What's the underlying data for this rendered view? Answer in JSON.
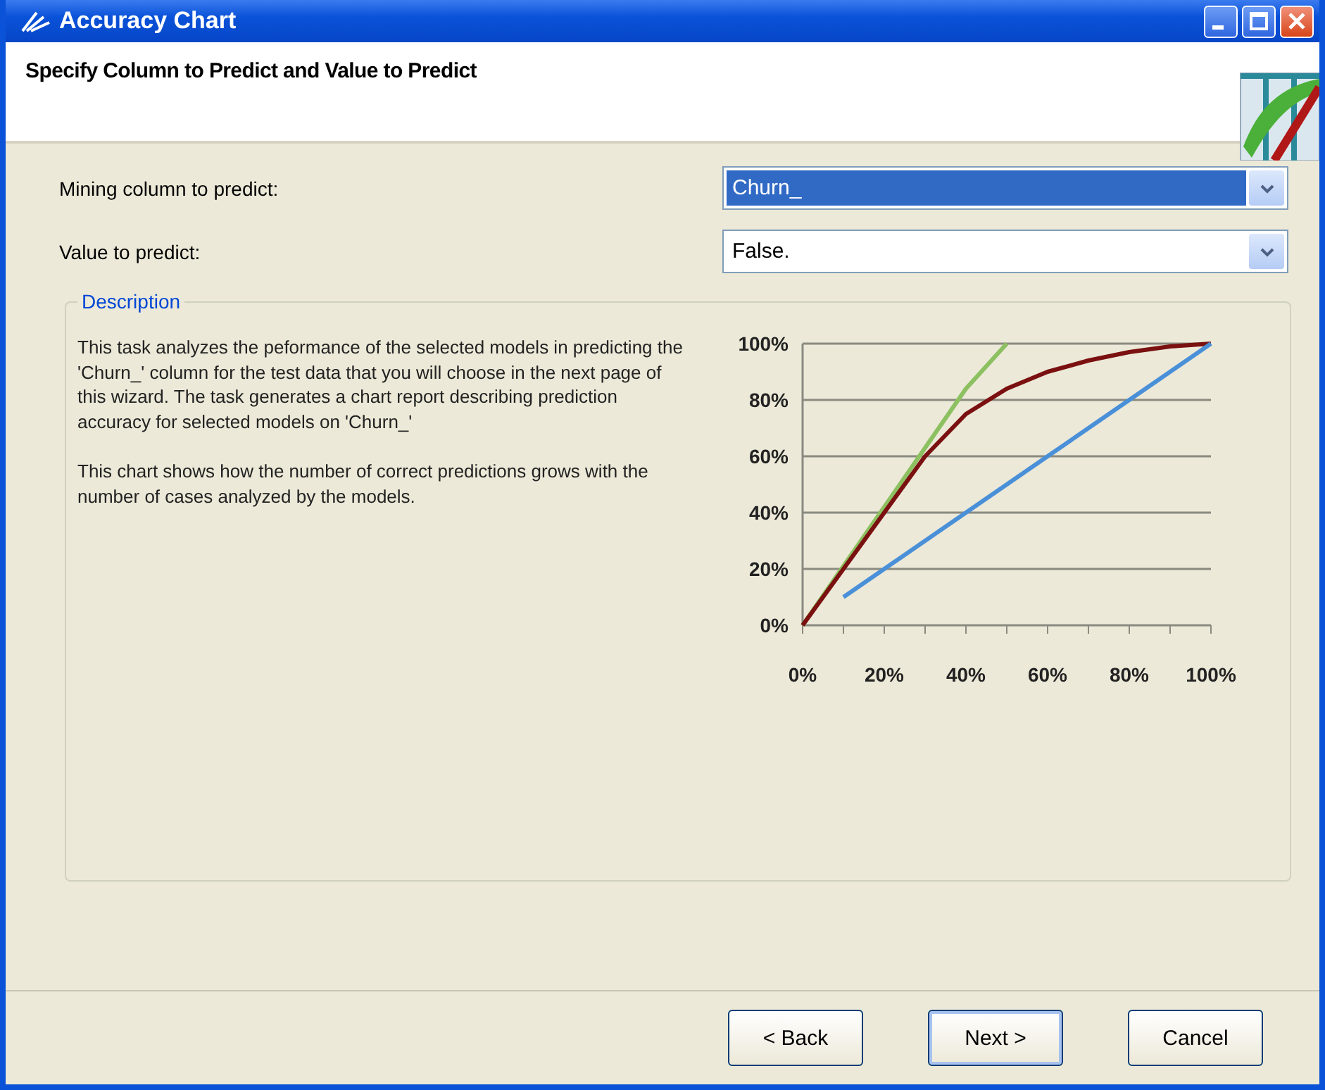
{
  "window": {
    "title": "Accuracy Chart",
    "controls": [
      {
        "kind": "minimize"
      },
      {
        "kind": "maximize"
      },
      {
        "kind": "close"
      }
    ]
  },
  "header": {
    "title": "Specify Column to Predict and Value to Predict"
  },
  "fields": [
    {
      "label": "Mining column to predict:",
      "value": "Churn_",
      "selected": true
    },
    {
      "label": "Value to predict:",
      "value": "False.",
      "selected": false
    }
  ],
  "description": {
    "legend": "Description",
    "paragraphs": [
      "This task analyzes the peformance of the selected models in predicting the 'Churn_' column for the test data that you will choose in the next page of this wizard. The task generates a chart report describing prediction accuracy for selected models on 'Churn_'",
      "This chart shows how the number of correct predictions grows with the number of cases analyzed by the models."
    ],
    "chart_data": {
      "type": "line",
      "x": [
        0,
        10,
        20,
        30,
        40,
        50,
        60,
        70,
        80,
        90,
        100
      ],
      "series": [
        {
          "color": "#8cc060",
          "values": [
            0,
            21,
            42,
            63,
            84,
            100,
            null,
            null,
            null,
            null,
            null
          ]
        },
        {
          "color": "#7a1010",
          "values": [
            0,
            20,
            40,
            60,
            75,
            84,
            90,
            94,
            97,
            99,
            100
          ]
        },
        {
          "color": "#4a90d8",
          "values": [
            null,
            10,
            20,
            30,
            40,
            50,
            60,
            70,
            80,
            90,
            100
          ]
        }
      ],
      "grid": true,
      "xlim": [
        0,
        100
      ],
      "ylim": [
        0,
        100
      ],
      "xticks": [
        {
          "value": 0,
          "label": "0%"
        },
        {
          "value": 20,
          "label": "20%"
        },
        {
          "value": 40,
          "label": "40%"
        },
        {
          "value": 60,
          "label": "60%"
        },
        {
          "value": 80,
          "label": "80%"
        },
        {
          "value": 100,
          "label": "100%"
        }
      ],
      "yticks": [
        {
          "value": 0,
          "label": "0%"
        },
        {
          "value": 20,
          "label": "20%"
        },
        {
          "value": 40,
          "label": "40%"
        },
        {
          "value": 60,
          "label": "60%"
        },
        {
          "value": 80,
          "label": "80%"
        },
        {
          "value": 100,
          "label": "100%"
        }
      ]
    }
  },
  "buttons": [
    {
      "label": "< Back",
      "default": false
    },
    {
      "label": "Next >",
      "default": true
    },
    {
      "label": "Cancel",
      "default": false
    }
  ]
}
